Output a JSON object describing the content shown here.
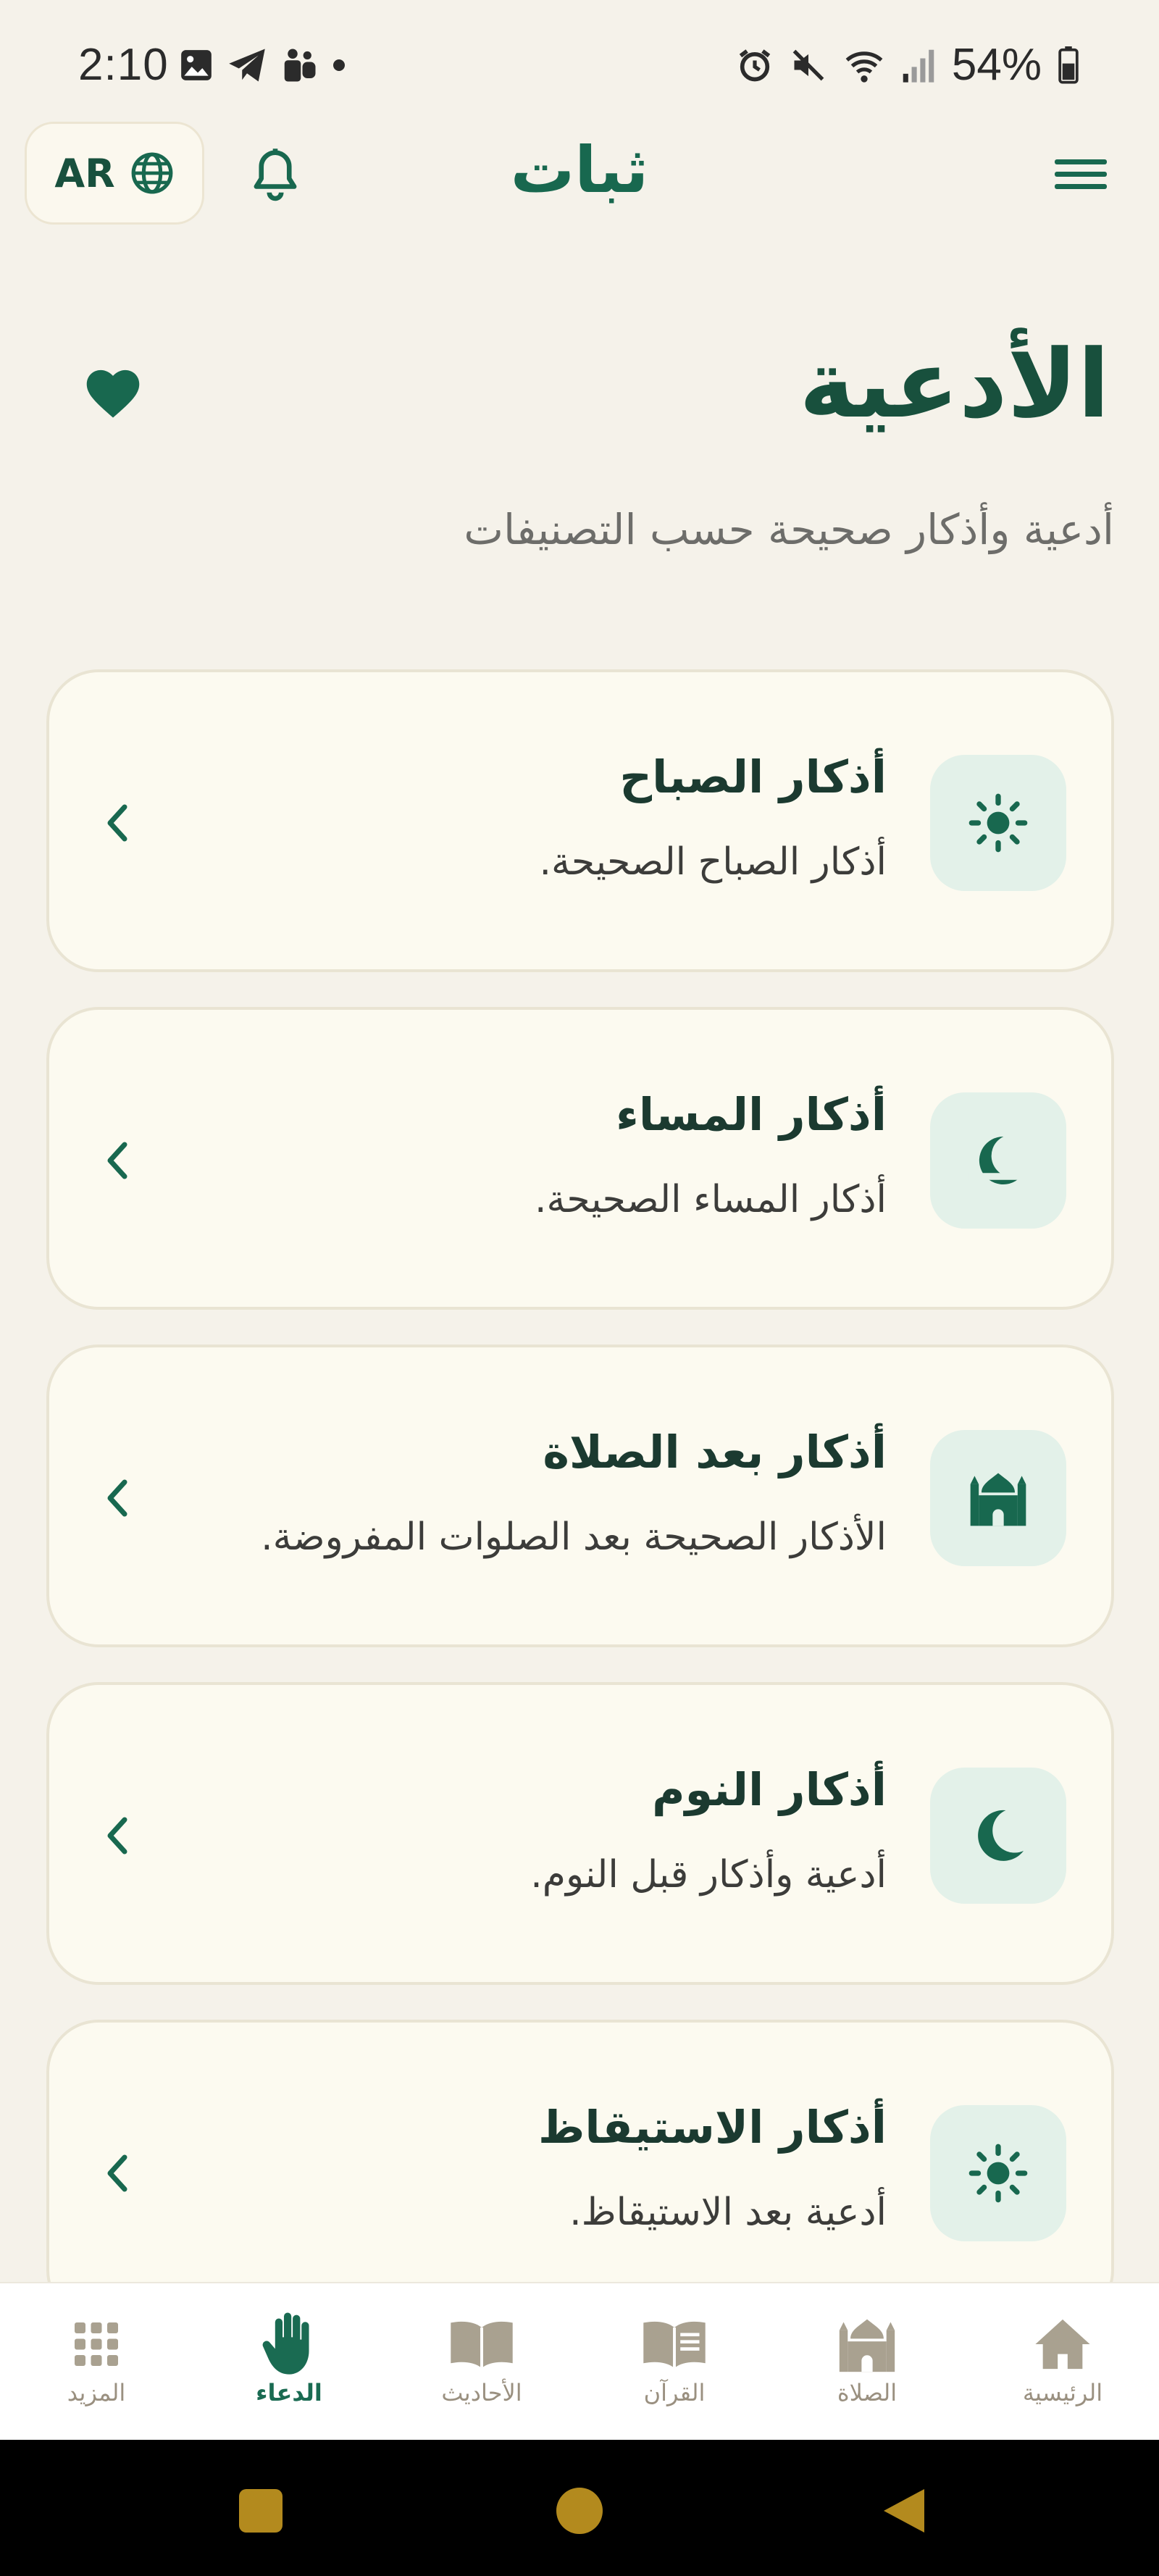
{
  "status_bar": {
    "time": "2:10",
    "battery_percent": "54%",
    "left_icons": [
      "image-icon",
      "telegram-icon",
      "teams-icon",
      "dot-icon"
    ],
    "right_icons": [
      "alarm-icon",
      "mute-icon",
      "wifi-icon",
      "signal-icon",
      "battery-icon"
    ]
  },
  "header": {
    "language_label": "AR",
    "app_title": "ثبات"
  },
  "page": {
    "title": "الأدعية",
    "subtitle": "أدعية وأذكار صحيحة حسب التصنيفات"
  },
  "categories": [
    {
      "title": "أذكار الصباح",
      "description": "أذكار الصباح الصحيحة.",
      "icon": "sun-icon"
    },
    {
      "title": "أذكار المساء",
      "description": "أذكار المساء الصحيحة.",
      "icon": "sunset-icon"
    },
    {
      "title": "أذكار بعد الصلاة",
      "description": "الأذكار الصحيحة بعد الصلوات المفروضة.",
      "icon": "mosque-icon"
    },
    {
      "title": "أذكار النوم",
      "description": "أدعية وأذكار قبل النوم.",
      "icon": "moon-icon"
    },
    {
      "title": "أذكار الاستيقاظ",
      "description": "أدعية بعد الاستيقاظ.",
      "icon": "sun-icon"
    }
  ],
  "bottom_nav": {
    "active": "الدعاء",
    "items": [
      {
        "label": "المزيد",
        "icon": "grid-icon"
      },
      {
        "label": "الدعاء",
        "icon": "hand-icon"
      },
      {
        "label": "الأحاديث",
        "icon": "open-book-icon"
      },
      {
        "label": "القرآن",
        "icon": "quran-icon"
      },
      {
        "label": "الصلاة",
        "icon": "mosque-icon"
      },
      {
        "label": "الرئيسية",
        "icon": "home-icon"
      }
    ]
  },
  "colors": {
    "background": "#f5f2ea",
    "primary": "#18684f",
    "card": "#fcfaf0",
    "icon_tile": "#e3f1e9",
    "nav_inactive": "#a9a190"
  }
}
